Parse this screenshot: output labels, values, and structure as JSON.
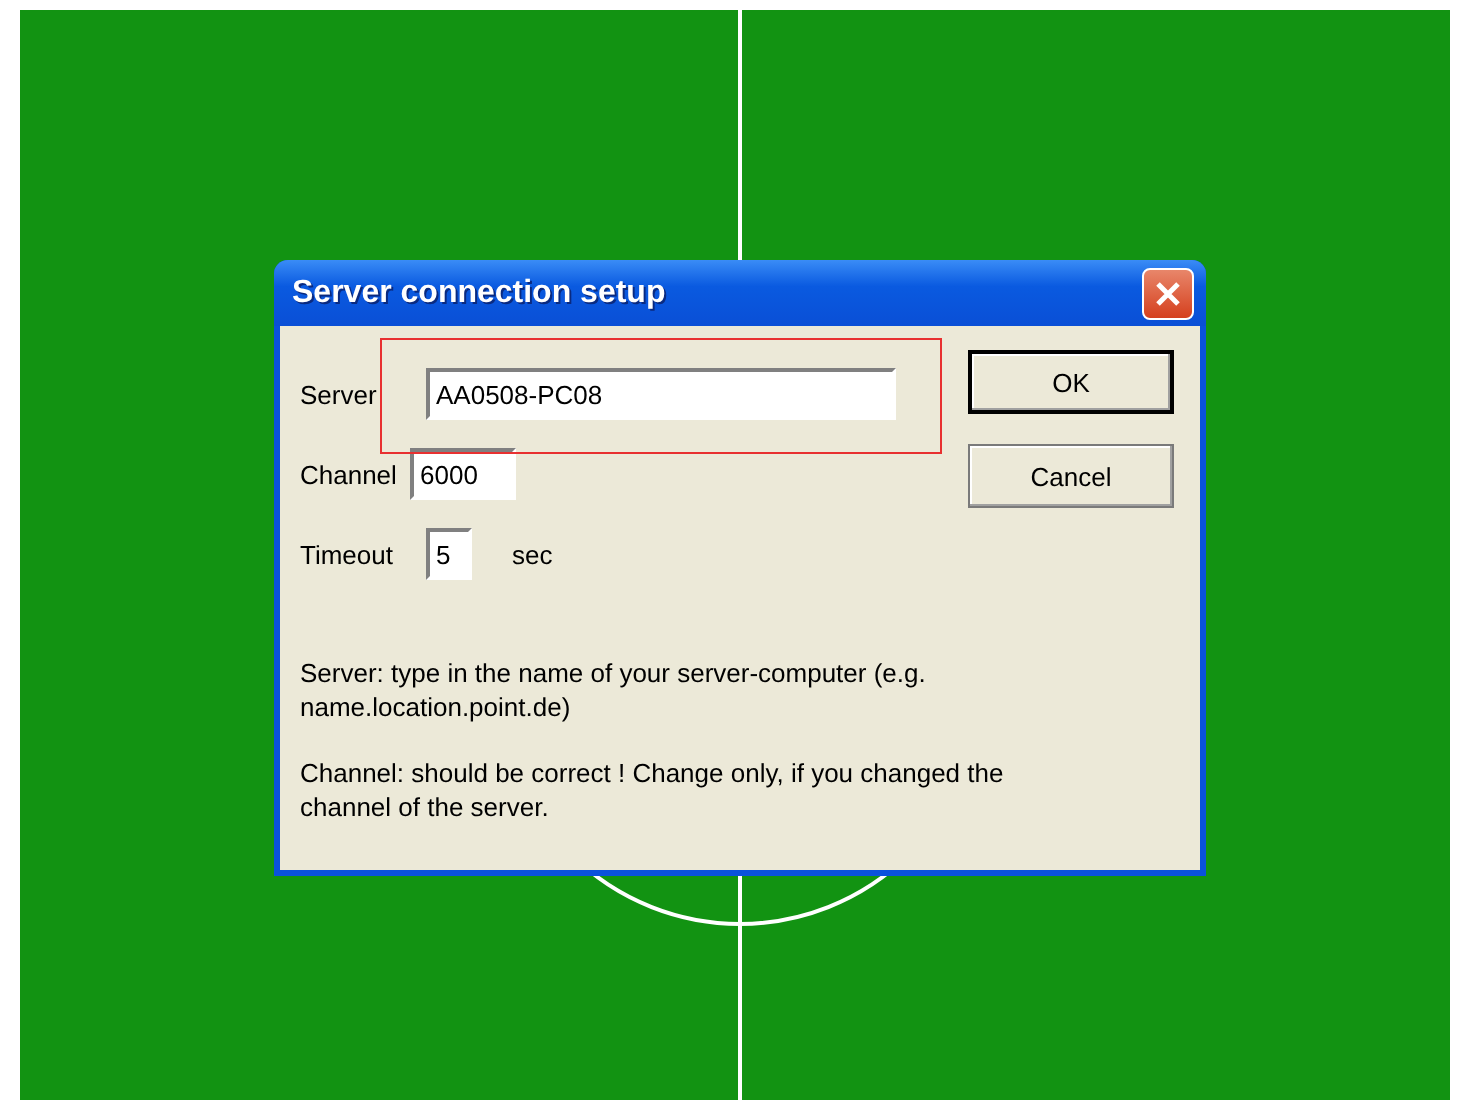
{
  "dialog": {
    "title": "Server connection setup",
    "fields": [
      {
        "label": "Server",
        "value": "AA0508-PC08",
        "highlighted": true
      },
      {
        "label": "Channel",
        "value": "6000",
        "highlighted": false
      },
      {
        "label": "Timeout",
        "value": "5",
        "unit": "sec",
        "highlighted": false
      }
    ],
    "buttons": [
      {
        "label": "OK",
        "default": true
      },
      {
        "label": "Cancel",
        "default": false
      }
    ],
    "help": [
      "Server: type in the name of your server-computer (e.g. name.location.point.de)",
      "Channel: should be correct ! Change only, if you changed  the channel of the server."
    ]
  }
}
